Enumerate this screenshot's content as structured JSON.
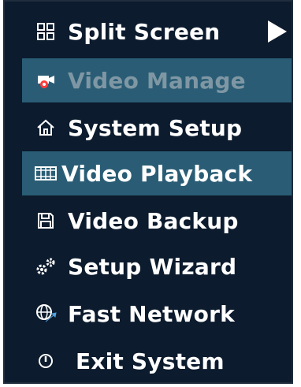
{
  "menu": {
    "items": [
      {
        "label": "Split Screen",
        "icon": "grid-icon",
        "has_submenu": true,
        "state": "normal"
      },
      {
        "label": "Video Manage",
        "icon": "camera-icon",
        "state": "disabled-highlighted"
      },
      {
        "label": "System Setup",
        "icon": "home-icon",
        "state": "normal"
      },
      {
        "label": "Video Playback",
        "icon": "film-icon",
        "state": "highlighted"
      },
      {
        "label": "Video Backup",
        "icon": "floppy-icon",
        "state": "normal"
      },
      {
        "label": "Setup Wizard",
        "icon": "gears-icon",
        "state": "normal"
      },
      {
        "label": "Fast Network",
        "icon": "globe-icon",
        "state": "normal"
      },
      {
        "label": "Exit System",
        "icon": "power-icon",
        "state": "normal"
      }
    ]
  },
  "colors": {
    "background": "#0c1b2d",
    "highlight": "#2a5d75",
    "disabled_text": "#7f97a4",
    "text": "#ffffff"
  }
}
